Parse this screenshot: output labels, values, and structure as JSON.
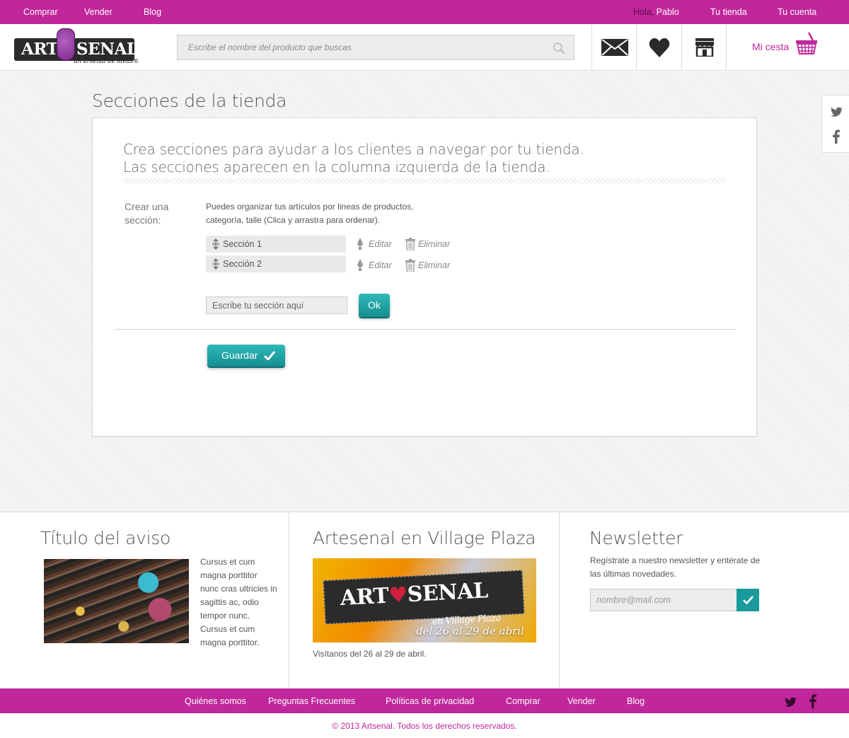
{
  "topbar": {
    "nav": [
      "Comprar",
      "Vender",
      "Blog"
    ],
    "greeting": "Hola,",
    "user": "Pablo",
    "your_store": "Tu tienda",
    "your_account": "Tu cuenta"
  },
  "header": {
    "logo": {
      "left": "ART",
      "right": "SENAL",
      "tagline": "un arsenal de ideas®"
    },
    "search_placeholder": "Escribe el nombre del producto que buscas",
    "icons": [
      "mail-icon",
      "heart-icon",
      "store-icon"
    ],
    "cart_label": "Mi cesta"
  },
  "colors": {
    "brand": "#c0279b",
    "accent": "#1a9a9b"
  },
  "page": {
    "title": "Secciones de la tienda",
    "intro_line1": "Crea secciones para ayudar a los clientes a navegar por tu tienda.",
    "intro_line2": "Las secciones aparecen en la columna izquierda de la tienda.",
    "field_label": "Crear una sección:",
    "help_text": "Puedes organizar tus artículos por lineas de productos, categoría, talle (Clica y arrastra   para ordenar).",
    "sections": [
      {
        "name": "Sección 1",
        "edit": "Editar",
        "delete": "Eliminar"
      },
      {
        "name": "Sección 2",
        "edit": "Editar",
        "delete": "Eliminar"
      }
    ],
    "new_section_placeholder": "Escribe tu sección aquí",
    "ok_label": "Ok",
    "save_label": "Guardar"
  },
  "footer_info": {
    "notice": {
      "title": "Título del aviso",
      "text": "Cursus et cum magna porttitor nunc cras ultricies in sagittis ac, odio tempor nunc. Cursus et cum magna porttitor."
    },
    "event": {
      "title": "Artesenal en Village Plaza",
      "banner_left": "ART",
      "banner_right": "SENAL",
      "banner_sub": "en Village Plaza",
      "banner_date": "del 26 al 29 de abril",
      "caption": "Visítanos del 26 al 29 de abril."
    },
    "newsletter": {
      "title": "Newsletter",
      "text": "Regístrate a nuestro newsletter y entérate de las últimas novedades.",
      "email_placeholder": "nombre@mail.com"
    }
  },
  "bottombar": {
    "links": [
      "Quiénes somos",
      "Preguntas Frecuentes",
      "Políticas de privacidad",
      "Comprar",
      "Vender",
      "Blog"
    ],
    "social": [
      "twitter-icon",
      "facebook-icon"
    ]
  },
  "copyright": "© 2013 Artsenal. Todos los derechos reservados."
}
